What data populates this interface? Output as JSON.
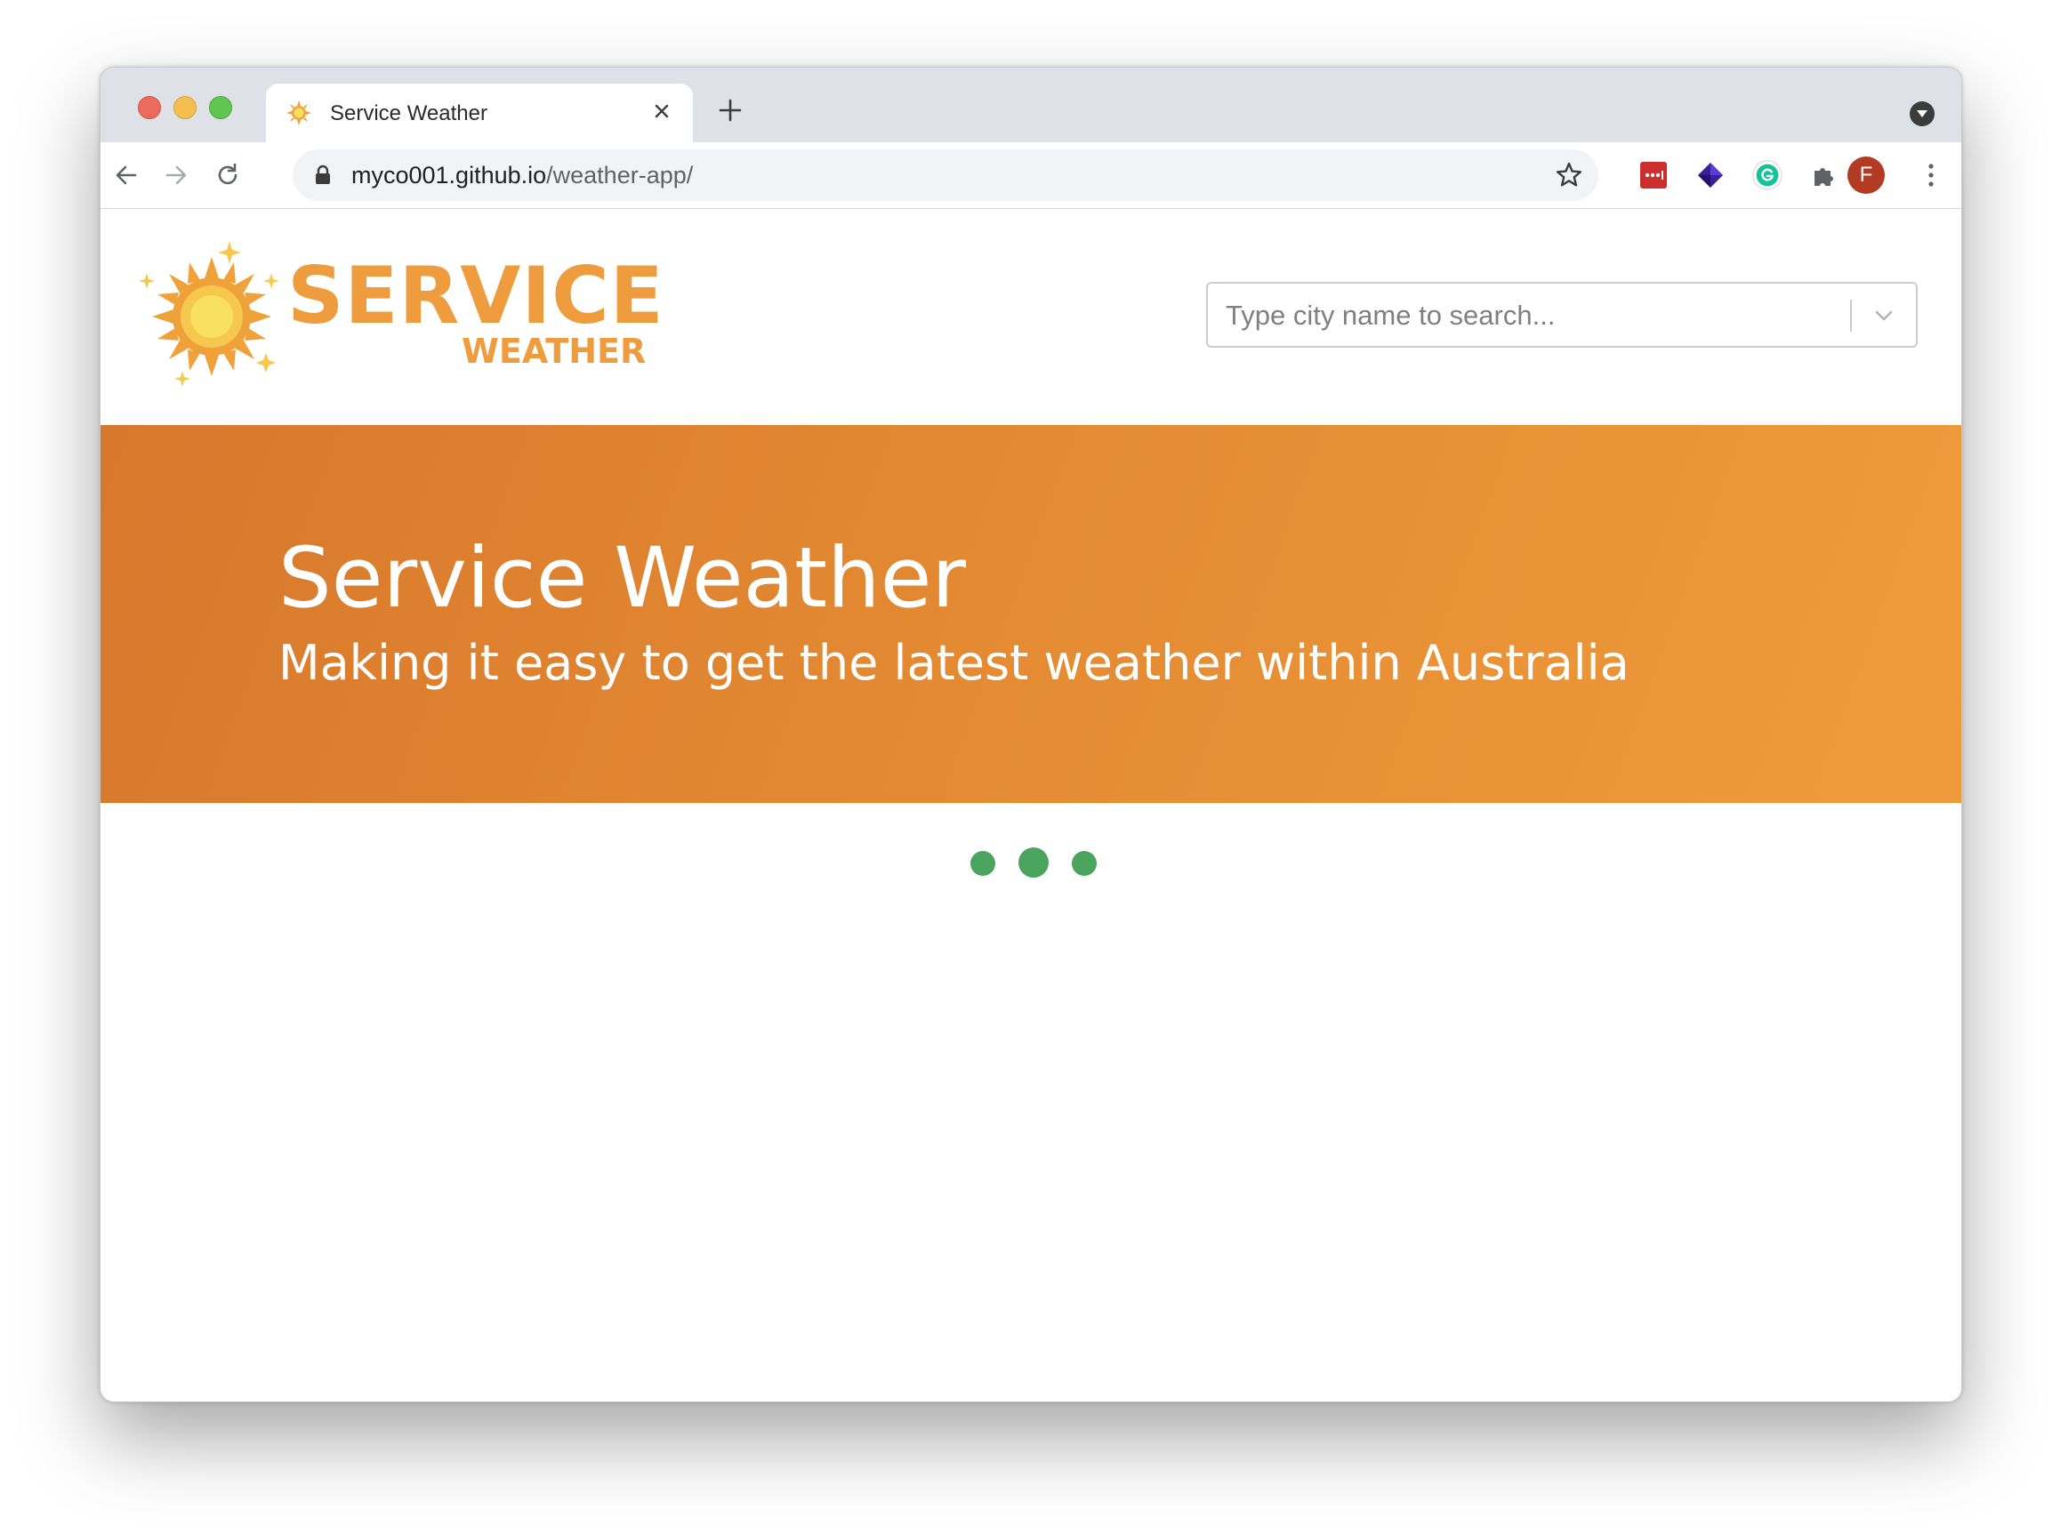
{
  "browser": {
    "tab": {
      "title": "Service Weather",
      "favicon": "sun-icon"
    },
    "address": {
      "host": "myco001.github.io",
      "path": "/weather-app/"
    },
    "profile_initial": "F",
    "extensions": [
      "lastpass-icon",
      "diamond-extension-icon",
      "grammarly-icon",
      "puzzle-icon"
    ]
  },
  "site": {
    "logo": {
      "title": "SERVICE",
      "subtitle": "WEATHER"
    },
    "search": {
      "placeholder": "Type city name to search...",
      "value": ""
    },
    "hero": {
      "title": "Service Weather",
      "subtitle": "Making it easy to get the latest weather within Australia"
    },
    "loader": {
      "dots": 3,
      "color": "#4aa45e"
    }
  },
  "colors": {
    "brand_orange": "#ef9c3e",
    "hero_gradient_start": "#d7782c",
    "hero_gradient_end": "#ef9b3b",
    "avatar": "#b33b24"
  }
}
